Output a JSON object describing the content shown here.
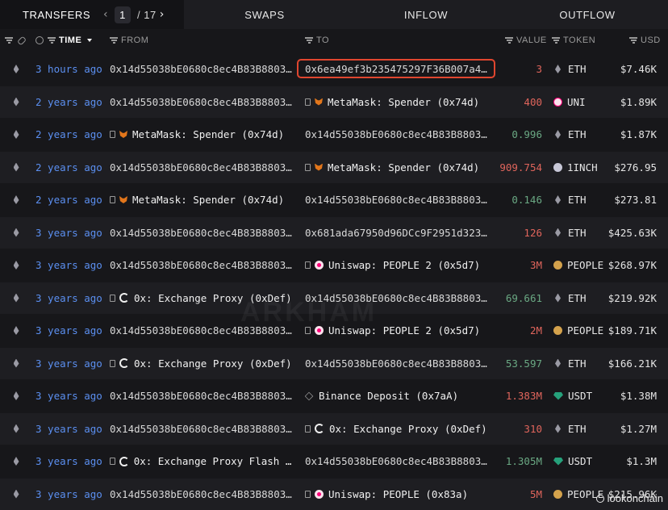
{
  "tabs": {
    "transfers": "TRANSFERS",
    "page_current": "1",
    "page_sep": "/",
    "page_total": "17",
    "swaps": "SWAPS",
    "inflow": "INFLOW",
    "outflow": "OUTFLOW"
  },
  "columns": {
    "time": "TIME",
    "from": "FROM",
    "to": "TO",
    "value": "VALUE",
    "token": "TOKEN",
    "usd": "USD"
  },
  "colors": {
    "accent_link": "#5b8ff0",
    "value_red": "#e0655c",
    "value_green": "#6aa883",
    "highlight_box": "#e0462f"
  },
  "watermark": "ARKHAM",
  "credit": "lookonchain",
  "rows": [
    {
      "time": "3 hours ago",
      "from": "0x14d55038bE0680c8ec4B83B8803F…",
      "from_icon": "",
      "to": "0x6ea49ef3b235475297F36B007a43…",
      "to_icon": "",
      "value": "3",
      "value_color": "red",
      "token": "ETH",
      "token_icon": "eth",
      "usd": "$7.46K"
    },
    {
      "time": "2 years ago",
      "from": "0x14d55038bE0680c8ec4B83B8803F…",
      "from_icon": "",
      "to": "MetaMask: Spender (0x74d)",
      "to_icon": "metamask",
      "value": "400",
      "value_color": "red",
      "token": "UNI",
      "token_icon": "uni",
      "usd": "$1.89K"
    },
    {
      "time": "2 years ago",
      "from": "MetaMask: Spender (0x74d)",
      "from_icon": "metamask",
      "to": "0x14d55038bE0680c8ec4B83B8803F…",
      "to_icon": "",
      "value": "0.996",
      "value_color": "green",
      "token": "ETH",
      "token_icon": "eth",
      "usd": "$1.87K"
    },
    {
      "time": "2 years ago",
      "from": "0x14d55038bE0680c8ec4B83B8803F…",
      "from_icon": "",
      "to": "MetaMask: Spender (0x74d)",
      "to_icon": "metamask",
      "value": "909.754",
      "value_color": "red",
      "token": "1INCH",
      "token_icon": "1inch",
      "usd": "$276.95"
    },
    {
      "time": "2 years ago",
      "from": "MetaMask: Spender (0x74d)",
      "from_icon": "metamask",
      "to": "0x14d55038bE0680c8ec4B83B8803F…",
      "to_icon": "",
      "value": "0.146",
      "value_color": "green",
      "token": "ETH",
      "token_icon": "eth",
      "usd": "$273.81"
    },
    {
      "time": "3 years ago",
      "from": "0x14d55038bE0680c8ec4B83B8803F…",
      "from_icon": "",
      "to": "0x681ada67950d96DCc9F2951d3235…",
      "to_icon": "",
      "value": "126",
      "value_color": "red",
      "token": "ETH",
      "token_icon": "eth",
      "usd": "$425.63K"
    },
    {
      "time": "3 years ago",
      "from": "0x14d55038bE0680c8ec4B83B8803F…",
      "from_icon": "",
      "to": "Uniswap: PEOPLE 2 (0x5d7)",
      "to_icon": "uniswap",
      "value": "3M",
      "value_color": "red",
      "token": "PEOPLE",
      "token_icon": "people",
      "usd": "$268.97K"
    },
    {
      "time": "3 years ago",
      "from": "0x: Exchange Proxy (0xDef)",
      "from_icon": "0x",
      "to": "0x14d55038bE0680c8ec4B83B8803F…",
      "to_icon": "",
      "value": "69.661",
      "value_color": "green",
      "token": "ETH",
      "token_icon": "eth",
      "usd": "$219.92K"
    },
    {
      "time": "3 years ago",
      "from": "0x14d55038bE0680c8ec4B83B8803F…",
      "from_icon": "",
      "to": "Uniswap: PEOPLE 2 (0x5d7)",
      "to_icon": "uniswap",
      "value": "2M",
      "value_color": "red",
      "token": "PEOPLE",
      "token_icon": "people",
      "usd": "$189.71K"
    },
    {
      "time": "3 years ago",
      "from": "0x: Exchange Proxy (0xDef)",
      "from_icon": "0x",
      "to": "0x14d55038bE0680c8ec4B83B8803F…",
      "to_icon": "",
      "value": "53.597",
      "value_color": "green",
      "token": "ETH",
      "token_icon": "eth",
      "usd": "$166.21K"
    },
    {
      "time": "3 years ago",
      "from": "0x14d55038bE0680c8ec4B83B8803F…",
      "from_icon": "",
      "to": "Binance Deposit (0x7aA)",
      "to_icon": "binance",
      "value": "1.383M",
      "value_color": "red",
      "token": "USDT",
      "token_icon": "usdt",
      "usd": "$1.38M"
    },
    {
      "time": "3 years ago",
      "from": "0x14d55038bE0680c8ec4B83B8803F…",
      "from_icon": "",
      "to": "0x: Exchange Proxy (0xDef)",
      "to_icon": "0x",
      "value": "310",
      "value_color": "red",
      "token": "ETH",
      "token_icon": "eth",
      "usd": "$1.27M"
    },
    {
      "time": "3 years ago",
      "from": "0x: Exchange Proxy Flash W…",
      "from_icon": "0x",
      "to": "0x14d55038bE0680c8ec4B83B8803F…",
      "to_icon": "",
      "value": "1.305M",
      "value_color": "green",
      "token": "USDT",
      "token_icon": "usdt",
      "usd": "$1.3M"
    },
    {
      "time": "3 years ago",
      "from": "0x14d55038bE0680c8ec4B83B8803F…",
      "from_icon": "",
      "to": "Uniswap: PEOPLE (0x83a)",
      "to_icon": "uniswap",
      "value": "5M",
      "value_color": "red",
      "token": "PEOPLE",
      "token_icon": "people",
      "usd": "$215.96K"
    }
  ]
}
